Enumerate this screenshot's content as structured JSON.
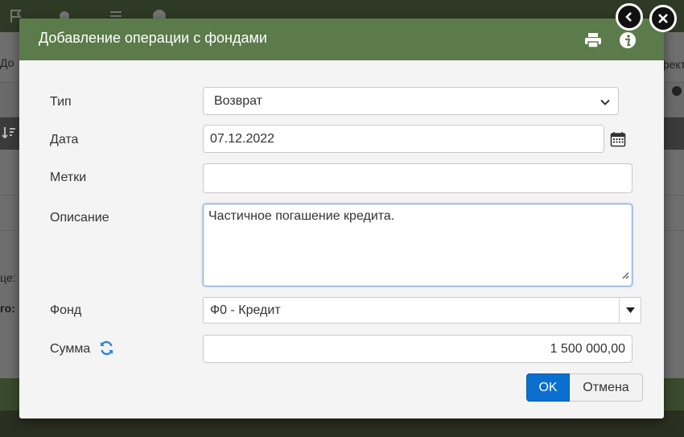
{
  "background": {
    "left_texts": {
      "row1": "До",
      "row2": "це:",
      "row3": "го:"
    },
    "right_text": "фект"
  },
  "dialog": {
    "title": "Добавление операции с фондами",
    "print_icon": "print-icon",
    "info_icon": "info-icon",
    "back_button_icon": "chevron-left-icon",
    "close_button_icon": "close-icon"
  },
  "form": {
    "type": {
      "label": "Тип",
      "value": "Возврат"
    },
    "date": {
      "label": "Дата",
      "value": "07.12.2022"
    },
    "tags": {
      "label": "Метки",
      "value": ""
    },
    "description": {
      "label": "Описание",
      "value": "Частичное погашение кредита."
    },
    "fund": {
      "label": "Фонд",
      "value": "Ф0 - Кредит"
    },
    "amount": {
      "label": "Сумма",
      "value": "1 500 000,00"
    }
  },
  "buttons": {
    "ok": "OK",
    "cancel": "Отмена"
  },
  "colors": {
    "header": "#5b7b4a",
    "primary_button": "#0b6fd0",
    "refresh_icon": "#2a83d6"
  }
}
